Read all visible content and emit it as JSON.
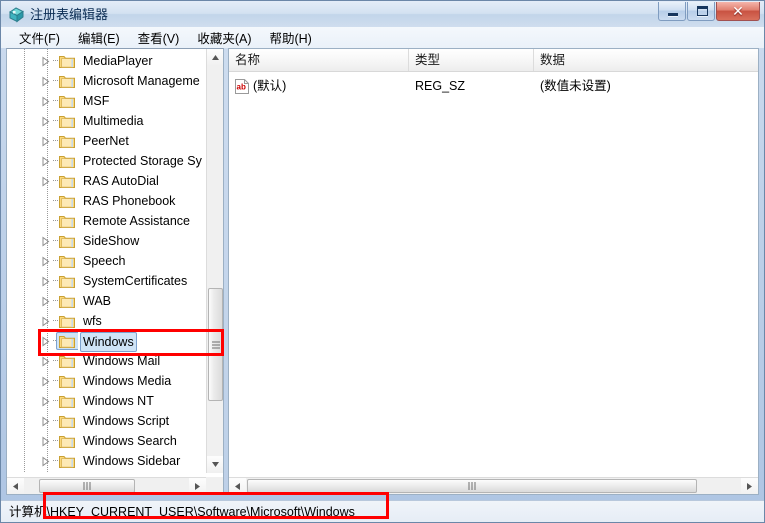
{
  "window": {
    "title": "注册表编辑器",
    "icon": "registry-editor-icon",
    "buttons": {
      "minimize": "最小化",
      "maximize": "最大化",
      "close": "关闭",
      "close_glyph": "✕"
    }
  },
  "menubar": {
    "items": [
      {
        "label": "文件(F)",
        "name": "menu-file"
      },
      {
        "label": "编辑(E)",
        "name": "menu-edit"
      },
      {
        "label": "查看(V)",
        "name": "menu-view"
      },
      {
        "label": "收藏夹(A)",
        "name": "menu-favorites"
      },
      {
        "label": "帮助(H)",
        "name": "menu-help"
      }
    ]
  },
  "tree": {
    "nodes": [
      {
        "label": "MediaPlayer",
        "expandable": true,
        "selected": false
      },
      {
        "label": "Microsoft Manageme",
        "expandable": true,
        "selected": false
      },
      {
        "label": "MSF",
        "expandable": true,
        "selected": false
      },
      {
        "label": "Multimedia",
        "expandable": true,
        "selected": false
      },
      {
        "label": "PeerNet",
        "expandable": true,
        "selected": false
      },
      {
        "label": "Protected Storage Sy",
        "expandable": true,
        "selected": false
      },
      {
        "label": "RAS AutoDial",
        "expandable": true,
        "selected": false
      },
      {
        "label": "RAS Phonebook",
        "expandable": false,
        "selected": false
      },
      {
        "label": "Remote Assistance",
        "expandable": false,
        "selected": false
      },
      {
        "label": "SideShow",
        "expandable": true,
        "selected": false
      },
      {
        "label": "Speech",
        "expandable": true,
        "selected": false
      },
      {
        "label": "SystemCertificates",
        "expandable": true,
        "selected": false
      },
      {
        "label": "WAB",
        "expandable": true,
        "selected": false
      },
      {
        "label": "wfs",
        "expandable": true,
        "selected": false
      },
      {
        "label": "Windows",
        "expandable": true,
        "selected": true
      },
      {
        "label": "Windows Mail",
        "expandable": true,
        "selected": false
      },
      {
        "label": "Windows Media",
        "expandable": true,
        "selected": false
      },
      {
        "label": "Windows NT",
        "expandable": true,
        "selected": false
      },
      {
        "label": "Windows Script",
        "expandable": true,
        "selected": false
      },
      {
        "label": "Windows Search",
        "expandable": true,
        "selected": false
      },
      {
        "label": "Windows Sidebar",
        "expandable": true,
        "selected": false
      }
    ]
  },
  "list": {
    "columns": [
      {
        "label": "名称",
        "name": "column-name"
      },
      {
        "label": "类型",
        "name": "column-type"
      },
      {
        "label": "数据",
        "name": "column-data"
      }
    ],
    "rows": [
      {
        "name": "(默认)",
        "type": "REG_SZ",
        "data": "(数值未设置)",
        "icon": "string-value-icon"
      }
    ]
  },
  "statusbar": {
    "path": "计算机\\HKEY_CURRENT_USER\\Software\\Microsoft\\Windows"
  },
  "colors": {
    "annotation": "#ff0000",
    "selection_fill": "#cfe4f7",
    "selection_border": "#7da2ce",
    "folder": "#fcd77f",
    "title_text": "#0c2d54"
  }
}
